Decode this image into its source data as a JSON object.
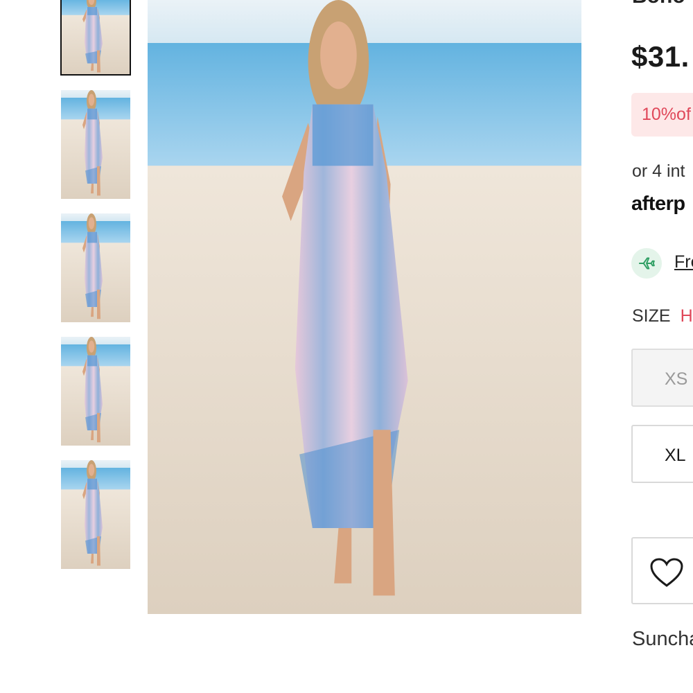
{
  "product": {
    "title": "Boho",
    "price": "$31.",
    "discount_badge": "10%of",
    "installments_text": "or 4 int",
    "afterpay_brand": "afterp",
    "shipping_link": "Fre",
    "size_label": "SIZE",
    "size_hint": "H",
    "sizes": [
      {
        "label": "XS",
        "state": "unavailable"
      },
      {
        "label": "XL",
        "state": "available"
      }
    ],
    "brand_text": "Suncha"
  },
  "gallery": {
    "thumbnail_count": 5,
    "active_index": 0
  },
  "icons": {
    "shipping": "airplane-icon",
    "wishlist": "heart-icon"
  },
  "colors": {
    "discount_text": "#e0485a",
    "discount_bg": "#fde8e8",
    "shipping_icon_bg": "#e4f4ea",
    "shipping_icon": "#2e9e63",
    "border": "#d9d9d9"
  }
}
